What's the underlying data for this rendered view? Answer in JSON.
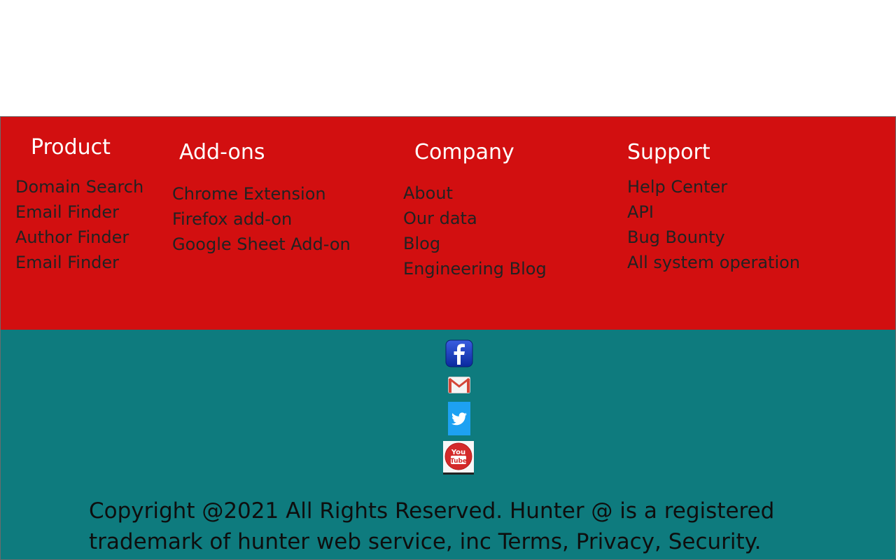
{
  "columns": [
    {
      "heading": "Product",
      "items": [
        "Domain Search",
        "Email Finder",
        "Author Finder",
        "Email Finder"
      ]
    },
    {
      "heading": "Add-ons",
      "items": [
        "Chrome Extension",
        "Firefox add-on",
        "Google Sheet Add-on"
      ]
    },
    {
      "heading": "Company",
      "items": [
        "About",
        "Our data",
        "Blog",
        "Engineering Blog"
      ]
    },
    {
      "heading": "Support",
      "items": [
        "Help Center",
        "API",
        "Bug Bounty",
        "All system operation"
      ]
    }
  ],
  "social": {
    "icons": [
      "facebook-icon",
      "gmail-icon",
      "twitter-icon",
      "youtube-icon"
    ],
    "youtube_text_1": "You",
    "youtube_text_2": "Tube"
  },
  "copyright": "Copyright @2021 All Rights Reserved. Hunter @ is a registered trademark of hunter web service, inc Terms, Privacy, Security.",
  "colors": {
    "links_bg": "#d20f10",
    "social_bg": "#0e7b7e",
    "heading_text": "#ffffff",
    "link_text": "#222222"
  }
}
